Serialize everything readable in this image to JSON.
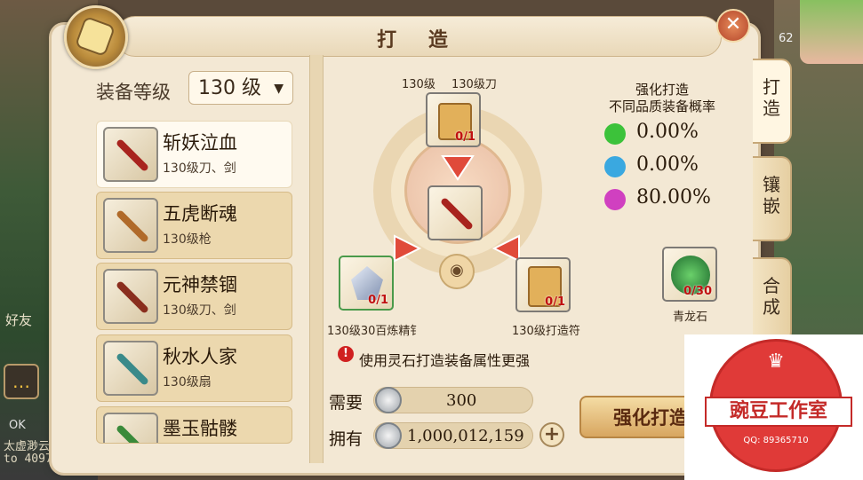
{
  "dialog": {
    "title": "打 造",
    "close_label": "✕"
  },
  "left_panel": {
    "level_label": "装备等级",
    "level_value": "130 级",
    "level_arrow": "▼",
    "items": [
      {
        "name": "斩妖泣血",
        "sub": "130级刀、剑",
        "icon": "blade-icon",
        "color": "#a8231e",
        "selected": true
      },
      {
        "name": "五虎断魂",
        "sub": "130级枪",
        "icon": "spear-icon",
        "color": "#b06a2a",
        "selected": false
      },
      {
        "name": "元神禁锢",
        "sub": "130级刀、剑",
        "icon": "scythe-icon",
        "color": "#8a2e1e",
        "selected": false
      },
      {
        "name": "秋水人家",
        "sub": "130级扇",
        "icon": "fan-icon",
        "color": "#3a8a8a",
        "selected": false
      },
      {
        "name": "墨玉骷髅",
        "sub": "",
        "icon": "staff-icon",
        "color": "#3a8a3a",
        "selected": false
      }
    ]
  },
  "forge": {
    "top_labels": {
      "level": "130级",
      "type": "130级刀"
    },
    "top_slot": {
      "count": "0/1",
      "icon": "scroll-icon"
    },
    "center_slot": {
      "icon": "blade-icon"
    },
    "left_slot": {
      "count": "0/1",
      "label": "130级30百炼精钅",
      "icon": "crystal-icon"
    },
    "right_slot": {
      "count": "0/1",
      "label": "130级打造符",
      "icon": "talisman-icon"
    },
    "stone_slot": {
      "count": "0/30",
      "label": "青龙石",
      "icon": "dragon-stone-icon"
    },
    "eye_icon": "eye-icon"
  },
  "probability": {
    "title_line1": "强化打造",
    "title_line2": "不同品质装备概率",
    "rows": [
      {
        "color": "#3cc23a",
        "pct": "0.00%"
      },
      {
        "color": "#3aa8e0",
        "pct": "0.00%"
      },
      {
        "color": "#d040c0",
        "pct": "80.00%"
      }
    ]
  },
  "note": {
    "icon": "!",
    "text": "使用灵石打造装备属性更强"
  },
  "cost": {
    "need_label": "需要",
    "need_value": "300",
    "have_label": "拥有",
    "have_value": "1,000,012,159",
    "plus": "+"
  },
  "forge_button": "强化打造",
  "side_tabs": [
    {
      "label": "打造",
      "active": true
    },
    {
      "label": "镶嵌",
      "active": false
    },
    {
      "label": "合成",
      "active": false
    }
  ],
  "watermark": {
    "title": "豌豆工作室",
    "qq": "QQ: 89365710"
  },
  "hud": {
    "friends": "好友",
    "chat_icon": "chat-icon",
    "ok_text": "OK",
    "line1": "太虚渺云",
    "line2": "to 4097.",
    "number": "62"
  }
}
